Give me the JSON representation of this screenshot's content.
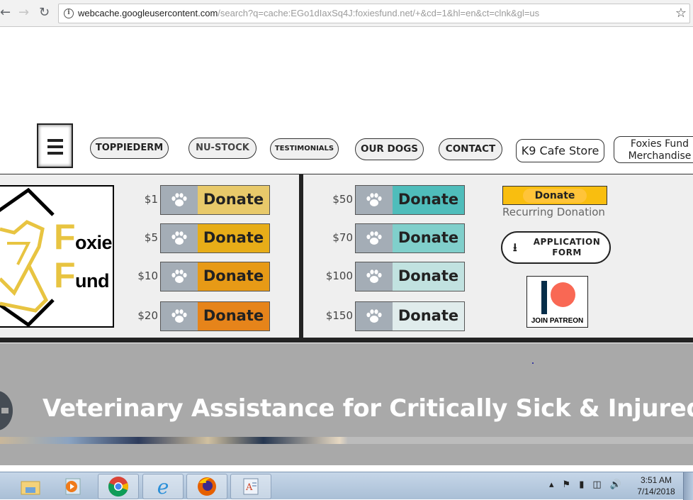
{
  "browser": {
    "url_host": "webcache.googleusercontent.com",
    "url_rest": "/search?q=cache:EGo1dIaxSq4J:foxiesfund.net/+&cd=1&hl=en&ct=clnk&gl=us",
    "icons": [
      "back-arrow-icon",
      "forward-arrow-icon",
      "reload-icon",
      "info-icon",
      "bookmark-star-icon"
    ]
  },
  "nav": {
    "menu_icon": "hamburger-menu-icon",
    "items": [
      {
        "label": "TOPPIEDERM"
      },
      {
        "label": "NU-STOCK"
      },
      {
        "label": "TESTIMONIALS"
      },
      {
        "label": "OUR DOGS"
      },
      {
        "label": "CONTACT"
      },
      {
        "label": "K9 Cafe Store"
      },
      {
        "label": "Foxies Fund Merchandise",
        "line1": "Foxies Fund",
        "line2": "Merchandise"
      }
    ]
  },
  "logo": {
    "word1_initial": "F",
    "word1_rest": "oxies",
    "word2_initial": "F",
    "word2_rest": "und"
  },
  "donations": {
    "button_label": "Donate",
    "left": [
      {
        "amount": "$1",
        "color": "#e8c96a"
      },
      {
        "amount": "$5",
        "color": "#e7ad18"
      },
      {
        "amount": "$10",
        "color": "#e79a16"
      },
      {
        "amount": "$20",
        "color": "#e6841a"
      }
    ],
    "right": [
      {
        "amount": "$50",
        "color": "#4fbdbb"
      },
      {
        "amount": "$70",
        "color": "#80cfcb"
      },
      {
        "amount": "$100",
        "color": "#c1e2e0"
      },
      {
        "amount": "$150",
        "color": "#e0ecec"
      }
    ],
    "paw_color": "#a4adb6"
  },
  "sidebar_actions": {
    "paypal_label": "Donate",
    "recurring_label": "Recurring Donation",
    "application_form_line1": "APPLICATION",
    "application_form_line2": "FORM",
    "patreon_label": "JOIN PATREON"
  },
  "hero": {
    "title": "Veterinary Assistance for Critically Sick & Injured Dogs"
  },
  "taskbar": {
    "apps": [
      "file-explorer-icon",
      "media-player-icon",
      "chrome-icon",
      "internet-explorer-icon",
      "firefox-icon",
      "wordpad-icon"
    ],
    "time": "3:51 AM",
    "date": "7/14/2018"
  }
}
